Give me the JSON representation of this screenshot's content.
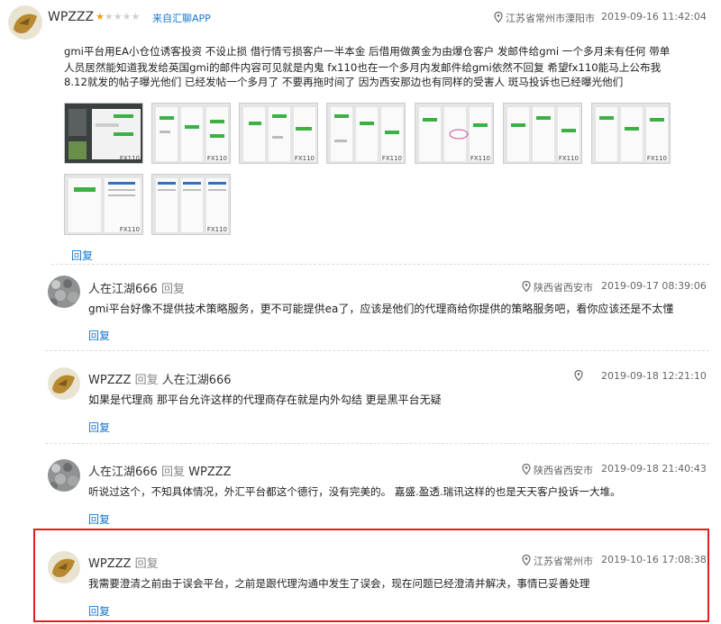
{
  "post": {
    "username": "WPZZZ",
    "stars": "★☆☆☆☆",
    "source": "来自汇聊APP",
    "location": "江苏省常州市溧阳市",
    "time": "2019-09-16 11:42:04",
    "body_lines": [
      "gmi平台用EA小仓位诱客投资 不设止损 借行情亏损客户一半本金 后借用做黄金为由爆仓客户 发邮件给gmi 一个多月未有任何 带单",
      "人员居然能知道我发给英国gmi的邮件内容可见就是内鬼 fx110也在一个多月内发邮件给gmi依然不回复 希望fx110能马上公布我",
      "8.12就发的帖子曝光他们 已经发帖一个多月了 不要再拖时间了 因为西安那边也有同样的受害人 斑马投诉也已经曝光他们"
    ],
    "thumb_label": "FX110",
    "reply_label": "回复"
  },
  "comments": [
    {
      "username": "人在江湖666",
      "reply_label": "回复",
      "reply_to": "",
      "location": "陕西省西安市",
      "time": "2019-09-17 08:39:06",
      "text": "gmi平台好像不提供技术策略服务，更不可能提供ea了，应该是他们的代理商给你提供的策略服务吧，看你应该还是不太懂",
      "action": "回复"
    },
    {
      "username": "WPZZZ",
      "reply_label": "回复",
      "reply_to": "人在江湖666",
      "location": "",
      "time": "2019-09-18 12:21:10",
      "text": "如果是代理商 那平台允许这样的代理商存在就是内外勾结 更是黑平台无疑",
      "action": "回复"
    },
    {
      "username": "人在江湖666",
      "reply_label": "回复",
      "reply_to": "WPZZZ",
      "location": "陕西省西安市",
      "time": "2019-09-18 21:40:43",
      "text": "听说过这个，不知具体情况，外汇平台都这个德行，没有完美的。 嘉盛.盈透.瑞讯这样的也是天天客户投诉一大堆。",
      "action": "回复"
    },
    {
      "username": "WPZZZ",
      "reply_label": "回复",
      "reply_to": "",
      "location": "江苏省常州市",
      "time": "2019-10-16 17:08:38",
      "text": "我需要澄清之前由于误会平台，之前是跟代理沟通中发生了误会，现在问题已经澄清并解决，事情已妥善处理",
      "action": "回复"
    }
  ],
  "colors": {
    "link": "#1677d2",
    "star": "#f39c12",
    "highlight": "#e02020"
  }
}
